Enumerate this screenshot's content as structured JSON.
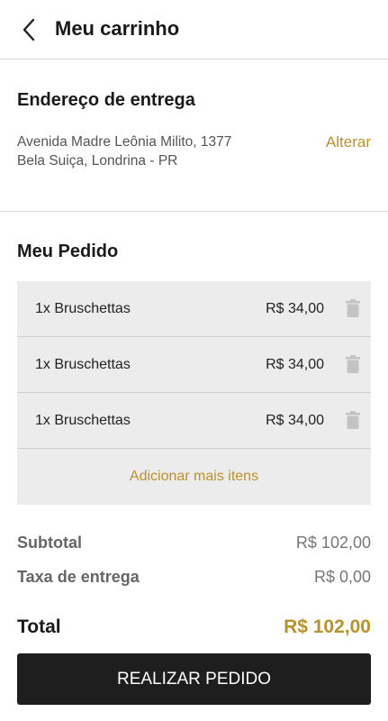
{
  "header": {
    "title": "Meu carrinho",
    "back_icon": "chevron-left-icon"
  },
  "address": {
    "heading": "Endereço de entrega",
    "line1": "Avenida Madre Leônia Milito, 1377",
    "line2": "Bela Suiça, Londrina - PR",
    "change_label": "Alterar"
  },
  "order": {
    "heading": "Meu Pedido",
    "items": [
      {
        "name": "1x Bruschettas",
        "price": "R$ 34,00"
      },
      {
        "name": "1x Bruschettas",
        "price": "R$ 34,00"
      },
      {
        "name": "1x Bruschettas",
        "price": "R$ 34,00"
      }
    ],
    "add_more_label": "Adicionar mais itens"
  },
  "summary": {
    "subtotal_label": "Subtotal",
    "subtotal_value": "R$ 102,00",
    "fee_label": "Taxa de entrega",
    "fee_value": "R$ 0,00",
    "total_label": "Total",
    "total_value": "R$ 102,00"
  },
  "cta": {
    "label": "REALIZAR PEDIDO"
  },
  "colors": {
    "accent": "#b9922b",
    "button_bg": "#1e1e1e",
    "box_bg": "#ececec"
  }
}
